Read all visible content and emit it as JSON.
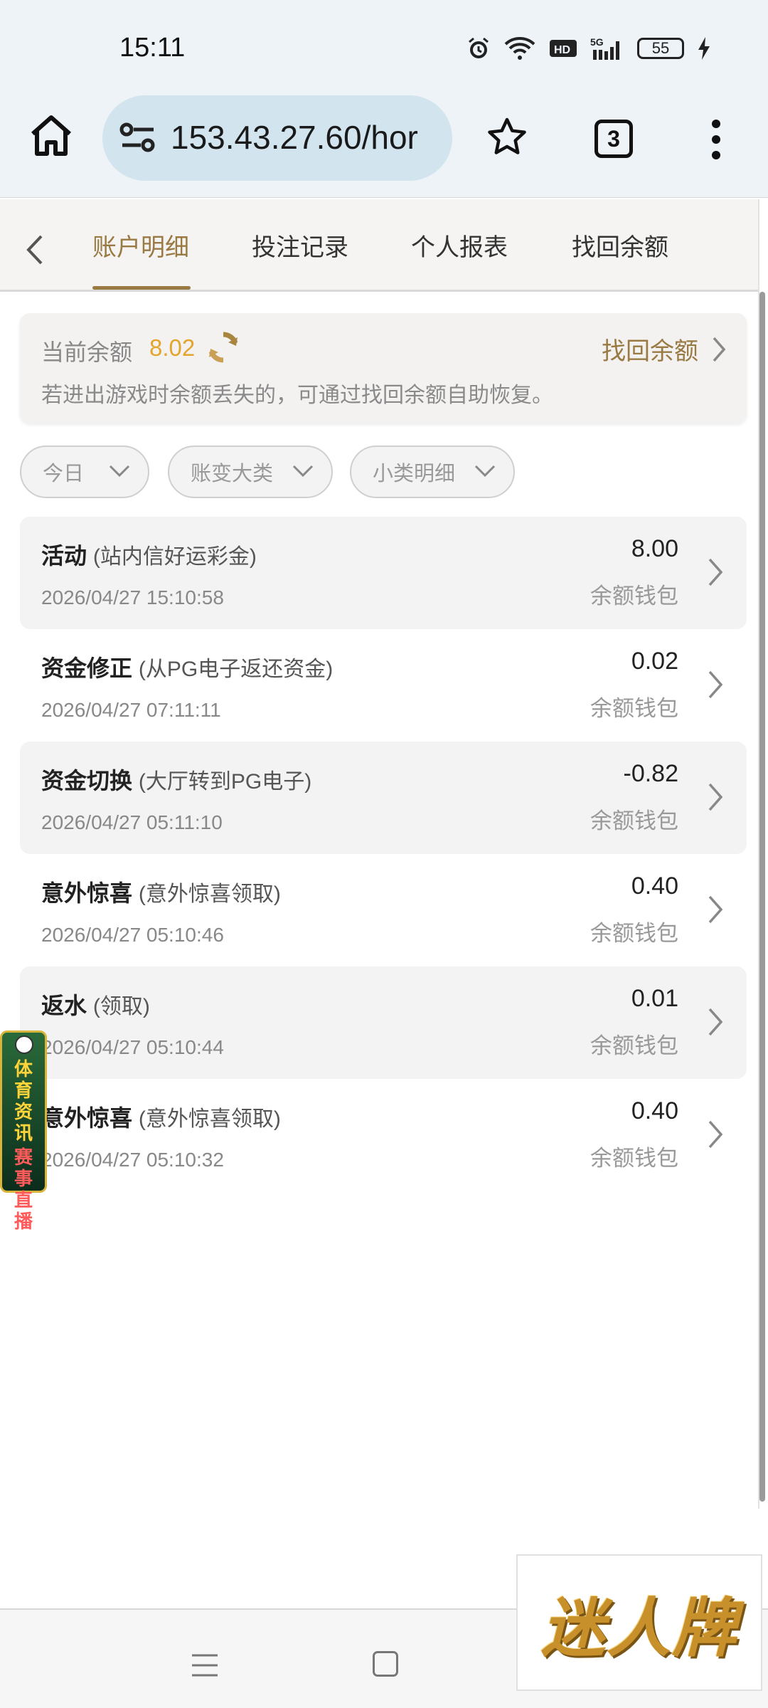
{
  "status_bar": {
    "time": "15:11",
    "battery": "55",
    "icons": [
      "alarm-icon",
      "wifi-icon",
      "hd-icon",
      "5g-signal-icon",
      "battery-icon",
      "charging-icon"
    ]
  },
  "browser": {
    "url": "153.43.27.60/hor",
    "tab_count": "3"
  },
  "tabs": [
    {
      "label": "账户明细",
      "active": true
    },
    {
      "label": "投注记录",
      "active": false
    },
    {
      "label": "个人报表",
      "active": false
    },
    {
      "label": "找回余额",
      "active": false
    }
  ],
  "balance": {
    "label": "当前余额",
    "value": "8.02",
    "recover_label": "找回余额",
    "note": "若进出游戏时余额丢失的，可通过找回余额自助恢复。"
  },
  "filters": [
    {
      "label": "今日"
    },
    {
      "label": "账变大类"
    },
    {
      "label": "小类明细"
    }
  ],
  "records": [
    {
      "title": "活动",
      "sub": "(站内信好运彩金)",
      "time": "2026/04/27 15:10:58",
      "amount": "8.00",
      "wallet": "余额钱包"
    },
    {
      "title": "资金修正",
      "sub": "(从PG电子返还资金)",
      "time": "2026/04/27 07:11:11",
      "amount": "0.02",
      "wallet": "余额钱包"
    },
    {
      "title": "资金切换",
      "sub": "(大厅转到PG电子)",
      "time": "2026/04/27 05:11:10",
      "amount": "-0.82",
      "wallet": "余额钱包"
    },
    {
      "title": "意外惊喜",
      "sub": "(意外惊喜领取)",
      "time": "2026/04/27 05:10:46",
      "amount": "0.40",
      "wallet": "余额钱包"
    },
    {
      "title": "返水",
      "sub": "(领取)",
      "time": "2026/04/27 05:10:44",
      "amount": "0.01",
      "wallet": "余额钱包"
    },
    {
      "title": "意外惊喜",
      "sub": "(意外惊喜领取)",
      "time": "2026/04/27 05:10:32",
      "amount": "0.40",
      "wallet": "余额钱包"
    }
  ],
  "floating_ad": {
    "line1": "体育资讯",
    "line2": "赛事直播"
  },
  "logo": {
    "text": "迷人牌"
  },
  "colors": {
    "accent": "#9a7a43",
    "balance": "#e3a52b",
    "row_shade": "#f3f3f3"
  }
}
